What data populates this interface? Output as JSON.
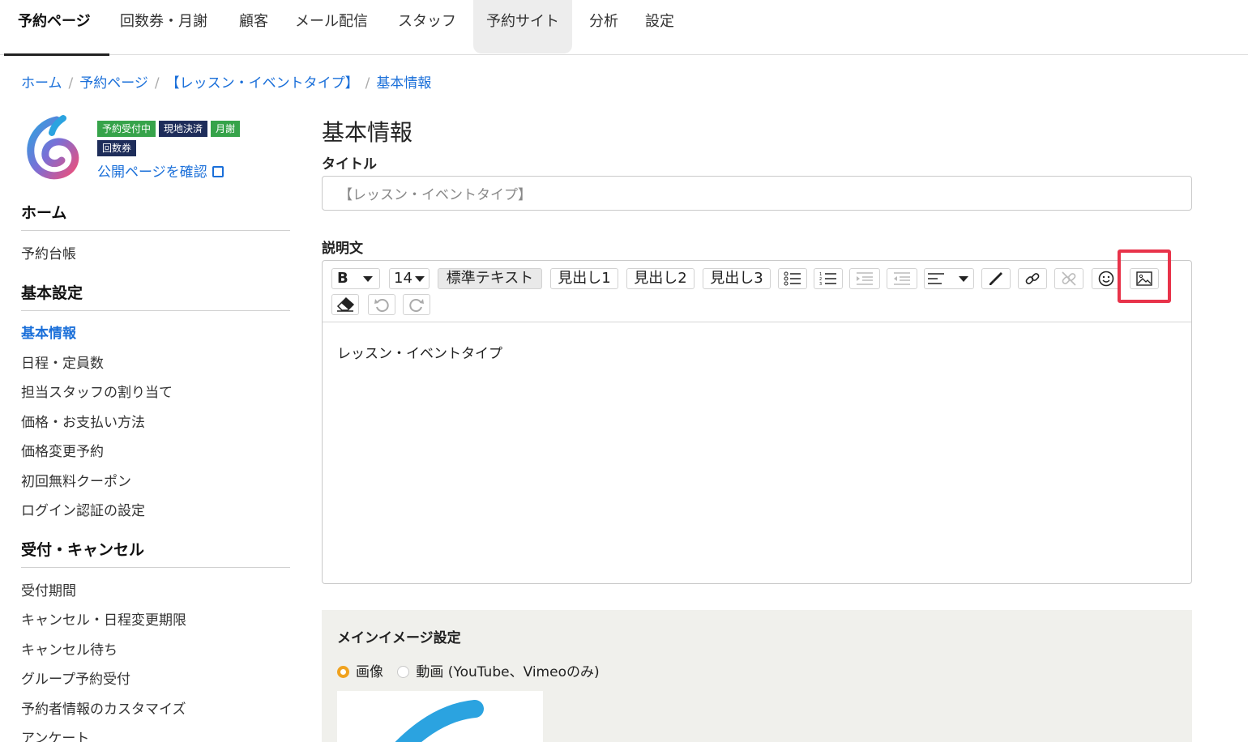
{
  "topnav": {
    "items": [
      {
        "label": "予約ページ"
      },
      {
        "label": "回数券・月謝"
      },
      {
        "label": "顧客"
      },
      {
        "label": "メール配信"
      },
      {
        "label": "スタッフ"
      },
      {
        "label": "予約サイト"
      },
      {
        "label": "分析"
      },
      {
        "label": "設定"
      }
    ]
  },
  "breadcrumb": [
    "ホーム",
    "予約ページ",
    "【レッスン・イベントタイプ】",
    "基本情報"
  ],
  "badges": [
    "予約受付中",
    "現地決済",
    "月謝",
    "回数券"
  ],
  "public_link": "公開ページを確認",
  "sidebar": {
    "home": "ホーム",
    "reservation_ledger": "予約台帳",
    "basic_settings": "基本設定",
    "basic_items": [
      "基本情報",
      "日程・定員数",
      "担当スタッフの割り当て",
      "価格・お支払い方法",
      "価格変更予約",
      "初回無料クーポン",
      "ログイン認証の設定"
    ],
    "reception_cancel": "受付・キャンセル",
    "reception_items": [
      "受付期間",
      "キャンセル・日程変更期限",
      "キャンセル待ち",
      "グループ予約受付",
      "予約者情報のカスタマイズ",
      "アンケート"
    ]
  },
  "main": {
    "page_title": "基本情報",
    "title_label": "タイトル",
    "title_value": "【レッスン・イベントタイプ】",
    "description_label": "説明文",
    "toolbar": {
      "bold": "B",
      "font_size": "14",
      "standard_text": "標準テキスト",
      "h1": "見出し1",
      "h2": "見出し2",
      "h3": "見出し3"
    },
    "editor_content": "レッスン・イベントタイプ",
    "image_panel": {
      "heading": "メインイメージ設定",
      "option_image": "画像",
      "option_video": "動画 (YouTube、Vimeoのみ)"
    }
  },
  "colors": {
    "link": "#1a6fd9",
    "badge_green": "#36a34a",
    "badge_navy": "#1e2d5a",
    "highlight": "#e8334a",
    "radio_selected": "#f0a21e"
  }
}
